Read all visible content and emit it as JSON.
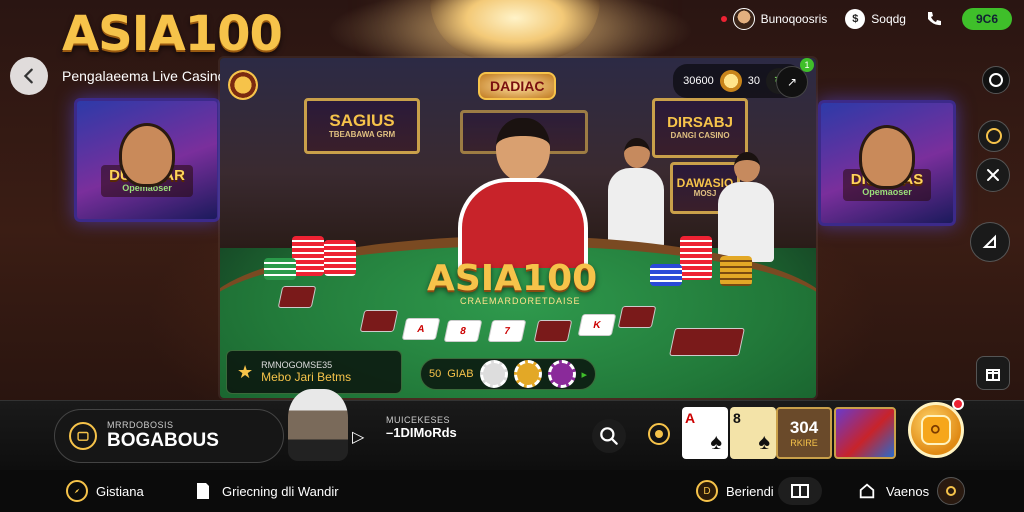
{
  "header": {
    "logo": "ASIA100",
    "tagline": "Pengalaeema Live Casino Terbaik di Ujung Jari ändi",
    "user_name": "Bunoqoosris",
    "wallet_label": "Soqdg",
    "action_label": "9C6"
  },
  "stage": {
    "top_badge": "DADIAC",
    "balance": "30600",
    "balance_unit": "30",
    "notification_count": "1",
    "wall_sign_left": "SAGIUS",
    "wall_sign_left_sub": "TBEABAWA GRM",
    "wall_sign_right": "DIRSABJ",
    "wall_sign_right_sub": "DANGI CASINO",
    "wall_sign_right2": "DAWASIO",
    "wall_sign_right2_sub": "MOSJ",
    "center_logo": "ASIA100",
    "center_sub": "CRAEMARDORETDAISE",
    "info_small": "RMNOGOMSE35",
    "info_big": "Mebo Jari Betms",
    "bet_value": "50",
    "bet_label": "GIAB"
  },
  "side_posters": {
    "left_title": "DUSGUAR",
    "left_sub": "Opemaoser",
    "right_title": "DIUSGIAS",
    "right_sub": "Opemaoser"
  },
  "bottom": {
    "left_small": "MRRDOBOSIS",
    "left_big": "BOGABOUS",
    "mid_small": "MUICEKESES",
    "mid_big": "–1DIMoRds",
    "card1_rank": "A",
    "card2_rank": "8",
    "count_value": "304",
    "count_label": "RKIRE"
  },
  "nav": {
    "item1": "Gistiana",
    "item2": "Griecning dli Wandir",
    "item3": "Beriendi",
    "item4": "Vaenos"
  },
  "colors": {
    "accent_gold": "#f6c34a",
    "felt_green": "#227a3a",
    "action_green": "#3fbf2a",
    "dealer_red": "#c8232a"
  }
}
